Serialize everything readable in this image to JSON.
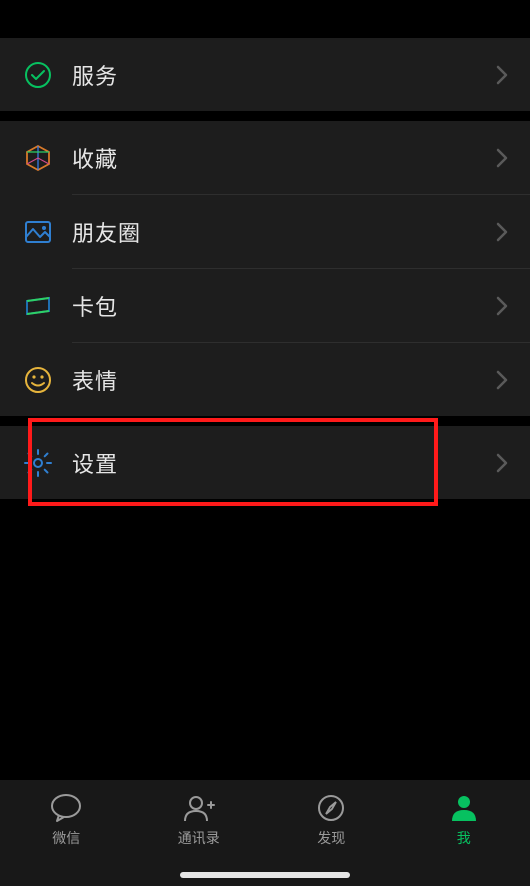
{
  "menu": {
    "services": {
      "label": "服务"
    },
    "favorites": {
      "label": "收藏"
    },
    "moments": {
      "label": "朋友圈"
    },
    "cards": {
      "label": "卡包"
    },
    "stickers": {
      "label": "表情"
    },
    "settings": {
      "label": "设置"
    }
  },
  "tabs": {
    "chats": {
      "label": "微信"
    },
    "contacts": {
      "label": "通讯录"
    },
    "discover": {
      "label": "发现"
    },
    "me": {
      "label": "我"
    }
  },
  "colors": {
    "accent": "#07c160",
    "highlight": "#ff1a1a"
  }
}
